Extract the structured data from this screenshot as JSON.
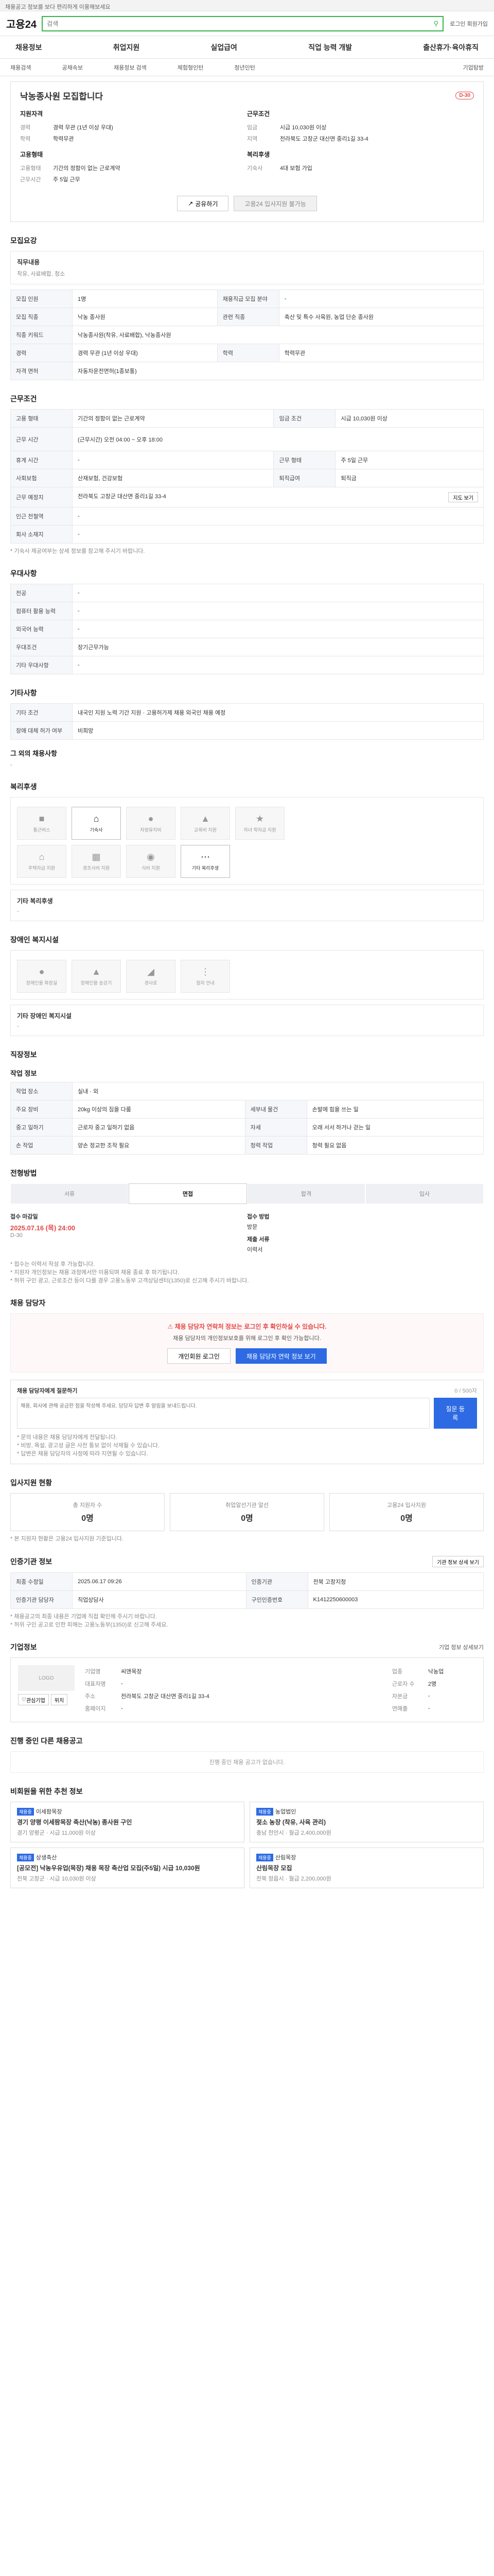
{
  "top_notice": "채용공고 정보를 보다 편리하게 이용해보세요",
  "header": {
    "logo": "고용24",
    "search_placeholder": "검색",
    "right_links": "로그인 회원가입"
  },
  "menu": [
    "채용정보",
    "취업지원",
    "실업급여",
    "직업 능력 개발",
    "출산휴가·육아휴직"
  ],
  "submenu": [
    "채용검색",
    "공채속보",
    "채용정보 검색",
    "체험형인턴",
    "청년인턴",
    "기업탐방"
  ],
  "job": {
    "title": "낙농종사원 모집합니다",
    "badge": "D-30",
    "summary_left_title": "지원자격",
    "summary_right_title": "근무조건",
    "fields_left": [
      {
        "k": "경력",
        "v": "경력 무관 (1년 이상 우대)"
      },
      {
        "k": "학력",
        "v": "학력무관"
      }
    ],
    "fields_right": [
      {
        "k": "임금",
        "v": "시급 10,030원 이상"
      },
      {
        "k": "지역",
        "v": "전라북도 고창군 대산면 중리1길 33-4"
      }
    ],
    "section2_left_title": "고용형태",
    "section2_right_title": "복리후생",
    "fields_left2": [
      {
        "k": "고용형태",
        "v": "기간의 정함이 없는 근로계약"
      },
      {
        "k": "근무시간",
        "v": "주 5일 근무"
      }
    ],
    "fields_right2": [
      {
        "k": "기숙사",
        "v": "4대 보험 가입"
      }
    ],
    "btn_share": "공유하기",
    "btn_apply": "고용24 입사지원 불가능"
  },
  "recruit": {
    "heading": "모집요강",
    "subheading": "직무내용",
    "duty_desc": "착유, 사료배합, 청소",
    "rows": [
      [
        "모집 인원",
        "1명",
        "채용직급 모집 분야",
        "-"
      ],
      [
        "모집 직종",
        "낙농 종사원",
        "관련 직종",
        "축산 및 특수 사육원, 농업 단순 종사원"
      ],
      [
        "직종 키워드",
        "낙농종사원(착유, 사료배합), 낙농종사원",
        "",
        ""
      ],
      [
        "경력",
        "경력 무관 (1년 이상 우대)",
        "학력",
        "학력무관"
      ],
      [
        "자격 면허",
        "자동차운전면허(1종보통)",
        "",
        ""
      ]
    ]
  },
  "conditions": {
    "heading": "근무조건",
    "rows": [
      [
        "고용 형태",
        "기간의 정함이 없는 근로계약",
        "임금 조건",
        "시급 10,030원 이상"
      ],
      [
        "근무 시간",
        "(근무시간) 오전 04:00 ~ 오후 18:00",
        "",
        ""
      ],
      [
        "휴게 시간",
        "-",
        "근무 형태",
        "주 5일 근무"
      ],
      [
        "사회보험",
        "산재보험, 건강보험",
        "퇴직급여",
        "퇴직금"
      ],
      [
        "근무 예정지",
        "전라북도 고창군 대산면 중리1길 33-4",
        "",
        ""
      ],
      [
        "인근 전철역",
        "-",
        "",
        ""
      ],
      [
        "회사 소재지",
        "-",
        "",
        ""
      ]
    ],
    "map_button": "지도 보기",
    "note": "* 기숙사 제공여부는 상세 정보를 참고해 주시기 바랍니다."
  },
  "prefs": {
    "heading": "우대사항",
    "rows": [
      [
        "전공",
        "-"
      ],
      [
        "컴퓨터 활용 능력",
        "-"
      ],
      [
        "외국어 능력",
        "-"
      ],
      [
        "우대조건",
        "장기근무가능"
      ],
      [
        "기타 우대사항",
        "-"
      ]
    ]
  },
  "other": {
    "heading": "기타사항",
    "rows": [
      [
        "기타 조건",
        "내국인 지원 노력 기간 지원 · 고용허가제 채용 외국인 채용 예정"
      ],
      [
        "장애 대체 허가 여부",
        "비희망"
      ]
    ],
    "etc_heading": "그 외의 채용사항",
    "etc_value": "-"
  },
  "welfare": {
    "heading": "복리후생",
    "icons": [
      "통근버스",
      "기숙사",
      "차량유지비",
      "교육비 지원",
      "자녀 학자금 지원",
      "주택자금 지원",
      "경조사비 지원",
      "식비 지원",
      "기타 복리후생"
    ],
    "active": [
      1,
      8
    ],
    "extra_heading": "기타 복리후생",
    "extra_value": "-"
  },
  "disability": {
    "heading": "장애인 복지시설",
    "icons": [
      "장애인용 화장실",
      "장애인용 승강기",
      "경사로",
      "점자 안내"
    ],
    "extra_heading": "기타 장애인 복지시설",
    "extra_value": "-"
  },
  "corp_info": {
    "heading": "직장정보",
    "subheading": "작업 정보",
    "rows": [
      [
        "작업 장소",
        "실내 · 외",
        "",
        ""
      ],
      [
        "주요 장비",
        "20kg 이상의 짐을 다룸",
        "세부내 물건",
        "손발에 힘을 쓰는 일"
      ],
      [
        "중고 일하기",
        "근로자 중고 일하기 없음",
        "자세",
        "오래 서서 하거나 걷는 일"
      ],
      [
        "손 작업",
        "양손 정교한 조작 필요",
        "청력 작업",
        "청력 필요 없음"
      ]
    ]
  },
  "process": {
    "heading": "전형방법",
    "steps": [
      "서류",
      "면접",
      "합격",
      "입사"
    ],
    "active_step": 1,
    "deadline_label": "접수 마감일",
    "deadline": "2025.07.16 (목) 24:00",
    "deadline_sub": "D-30",
    "method_label": "접수 방법",
    "method": "방문",
    "docs_label": "제출 서류",
    "docs": "이력서",
    "notes": [
      "* 접수는 이력서 작성 후 가능합니다.",
      "* 지원자 개인정보는 채용 과정에서만 이용되며 채용 종료 후 파기됩니다.",
      "* 허위 구인 광고, 근로조건 등이 다를 경우 고용노동부 고객상담센터(1350)로 신고해 주시기 바랍니다."
    ]
  },
  "contact": {
    "heading": "채용 담당자",
    "warn_title": "채용 담당자 연락처 정보는 로그인 후 확인하실 수 있습니다.",
    "warn_desc": "채용 담당자의 개인정보보호를 위해 로그인 후 확인 가능합니다.",
    "btn_login": "개인회원 로그인",
    "btn_view": "채용 담당자 연락 정보 보기"
  },
  "reply": {
    "heading": "채용 담당자에게 질문하기",
    "counter": "0 / 500자",
    "placeholder": "채용, 회사에 관해 궁금한 점을 작성해 주세요. 담당자 답변 후 알림을 보내드립니다.",
    "submit": "질문 등록",
    "notes": [
      "* 문의 내용은 채용 담당자에게 전달됩니다.",
      "* 비방, 욕설, 광고성 글은 사전 통보 없이 삭제될 수 있습니다.",
      "* 답변은 채용 담당자의 사정에 따라 지연될 수 있습니다."
    ]
  },
  "applicants": {
    "heading": "입사지원 현황",
    "items": [
      {
        "label": "총 지원자 수",
        "value": "0명"
      },
      {
        "label": "취업알선기관 알선",
        "value": "0명"
      },
      {
        "label": "고용24 입사지원",
        "value": "0명"
      }
    ],
    "note": "* 본 지원자 현황은 고용24 입사지원 기준입니다."
  },
  "info": {
    "heading": "인증기관 정보",
    "btn": "기관 정보 상세 보기",
    "rows": [
      [
        "최종 수정일",
        "2025.06.17 09:26",
        "인증기관",
        "전북 고창지청"
      ],
      [
        "인증기관 담당자",
        "직업상담사",
        "구인인증번호",
        "K1412250600003"
      ]
    ],
    "notes": [
      "* 채용공고의 최종 내용은 기업에 직접 확인해 주시기 바랍니다.",
      "* 허위 구인 공고로 인한 피해는 고용노동부(1350)로 신고해 주세요."
    ]
  },
  "company": {
    "heading": "기업정보",
    "link": "기업 정보 상세보기",
    "logo_text": "LOGO",
    "btn_follow": "관심기업",
    "btn_map": "위치",
    "rows": [
      [
        "기업명",
        "씨앤목장",
        "업종",
        "낙농업"
      ],
      [
        "대표자명",
        "-",
        "근로자 수",
        "2명"
      ],
      [
        "주소",
        "전라북도 고창군 대산면 중리1길 33-4",
        "자본금",
        "-"
      ],
      [
        "홈페이지",
        "-",
        "연매출",
        "-"
      ]
    ]
  },
  "other_jobs": {
    "heading": "진행 중인 다른 채용공고",
    "empty": "진행 중인 채용 공고가 없습니다."
  },
  "recommend": {
    "heading": "비회원을 위한 추천 정보",
    "items": [
      {
        "tag": "채용중",
        "company": "이세팜목장",
        "title": "경기 양평 이세팜목장 축산(낙농) 종사원 구인",
        "meta": "경기 양평군 · 시급 11,000원 이상"
      },
      {
        "tag": "채용중",
        "company": "농업법인",
        "title": "젖소 농장 (착유, 사육 관리)",
        "meta": "충남 천안시 · 월급 2,400,000원"
      },
      {
        "tag": "채용중",
        "company": "상생축산",
        "title": "[공모전] 낙농우유업(목장) 채용 목장 축산업 모집(주5일) 시급 10,030원",
        "meta": "전북 고창군 · 시급 10,030원 이상"
      },
      {
        "tag": "채용중",
        "company": "산림목장",
        "title": "산림목장 모집",
        "meta": "전북 정읍시 · 월급 2,200,000원"
      }
    ]
  },
  "icons": {
    "share": "share-icon",
    "welfare": "bus-icon"
  }
}
